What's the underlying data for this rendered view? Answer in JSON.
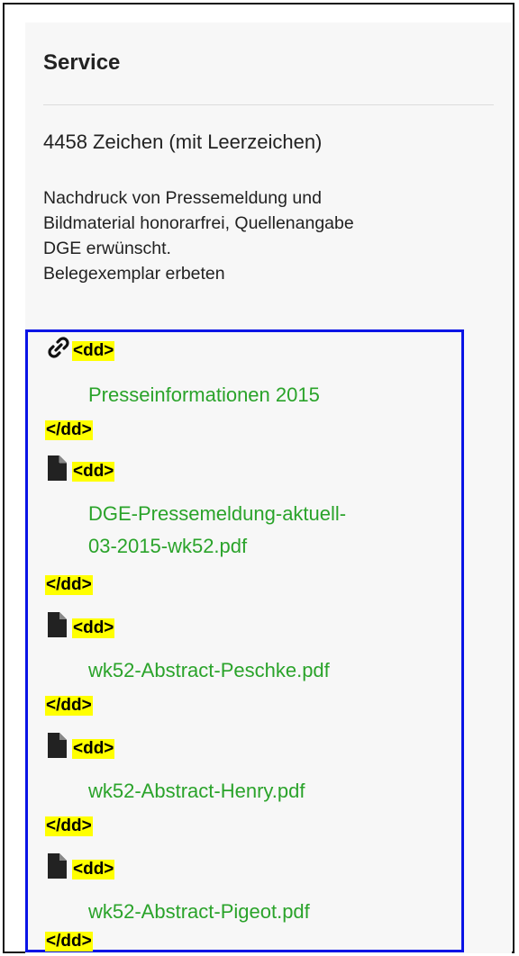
{
  "service": {
    "title": "Service",
    "char_count": "4458 Zeichen (mit Leerzeichen)",
    "notes": [
      "Nachdruck von Pressemeldung und",
      "Bildmaterial honorarfrei, Quellenangabe",
      "DGE erwünscht.",
      "Belegexemplar erbeten"
    ]
  },
  "tags": {
    "open": "<dd>",
    "close": "</dd>"
  },
  "links": [
    {
      "icon": "link-icon",
      "lines": [
        "Presseinformationen 2015"
      ]
    },
    {
      "icon": "file-icon",
      "lines": [
        "DGE-Pressemeldung-aktuell-",
        "03-2015-wk52.pdf"
      ]
    },
    {
      "icon": "file-icon",
      "lines": [
        "wk52-Abstract-Peschke.pdf"
      ]
    },
    {
      "icon": "file-icon",
      "lines": [
        "wk52-Abstract-Henry.pdf"
      ]
    },
    {
      "icon": "file-icon",
      "lines": [
        "wk52-Abstract-Pigeot.pdf"
      ]
    }
  ],
  "colors": {
    "link": "#2aa32a",
    "tag_highlight": "#ffff00",
    "box_border": "#0a14e6"
  }
}
